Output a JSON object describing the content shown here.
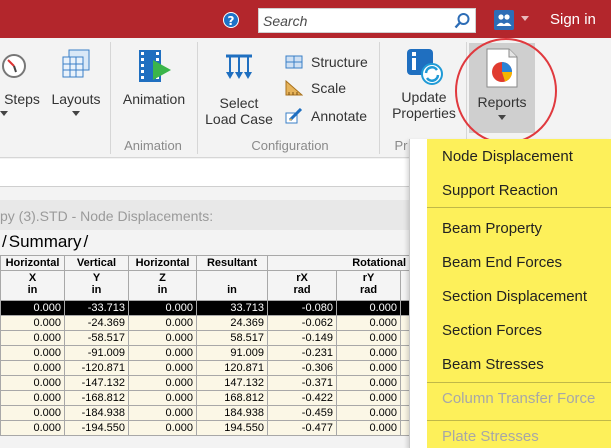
{
  "titlebar": {
    "search_placeholder": "Search",
    "signin_label": "Sign in",
    "help_label": "?"
  },
  "ribbon": {
    "steps_label": "Steps",
    "layouts_label": "Layouts",
    "animation_label": "Animation",
    "animation_group": "Animation",
    "select_load_case_line1": "Select",
    "select_load_case_line2": "Load Case",
    "structure_label": "Structure",
    "scale_label": "Scale",
    "annotate_label": "Annotate",
    "configuration_group": "Configuration",
    "update_properties_line1": "Update",
    "update_properties_line2": "Properties",
    "pr_group_fragment": "Pr",
    "reports_label": "Reports"
  },
  "document": {
    "title": "py (3).STD - Node Displacements:",
    "tab_summary": "Summary"
  },
  "table": {
    "header_row1": [
      "Horizontal",
      "Vertical",
      "Horizontal",
      "Resultant",
      "Rotational"
    ],
    "header_row2": [
      {
        "axis": "X",
        "unit": "in"
      },
      {
        "axis": "Y",
        "unit": "in"
      },
      {
        "axis": "Z",
        "unit": "in"
      },
      {
        "axis": "",
        "unit": "in"
      },
      {
        "axis": "rX",
        "unit": "rad"
      },
      {
        "axis": "rY",
        "unit": "rad"
      }
    ],
    "rows": [
      [
        "0.000",
        "-33.713",
        "0.000",
        "33.713",
        "-0.080",
        "0.000"
      ],
      [
        "0.000",
        "-24.369",
        "0.000",
        "24.369",
        "-0.062",
        "0.000"
      ],
      [
        "0.000",
        "-58.517",
        "0.000",
        "58.517",
        "-0.149",
        "0.000"
      ],
      [
        "0.000",
        "-91.009",
        "0.000",
        "91.009",
        "-0.231",
        "0.000"
      ],
      [
        "0.000",
        "-120.871",
        "0.000",
        "120.871",
        "-0.306",
        "0.000"
      ],
      [
        "0.000",
        "-147.132",
        "0.000",
        "147.132",
        "-0.371",
        "0.000"
      ],
      [
        "0.000",
        "-168.812",
        "0.000",
        "168.812",
        "-0.422",
        "0.000"
      ],
      [
        "0.000",
        "-184.938",
        "0.000",
        "184.938",
        "-0.459",
        "0.000"
      ],
      [
        "0.000",
        "-194.550",
        "0.000",
        "194.550",
        "-0.477",
        "0.000"
      ]
    ]
  },
  "menu": {
    "items": [
      {
        "label": "Node Displacement",
        "enabled": true
      },
      {
        "label": "Support Reaction",
        "enabled": true
      },
      {
        "label": "Beam Property",
        "enabled": true
      },
      {
        "label": "Beam End Forces",
        "enabled": true
      },
      {
        "label": "Section Displacement",
        "enabled": true
      },
      {
        "label": "Section Forces",
        "enabled": true
      },
      {
        "label": "Beam Stresses",
        "enabled": true
      },
      {
        "label": "Column Transfer Force",
        "enabled": false
      },
      {
        "label": "Plate Stresses",
        "enabled": false
      }
    ]
  },
  "colors": {
    "titlebar": "#b3262c",
    "menu_highlight": "#fdf05a",
    "callout_circle": "#e0393e"
  }
}
